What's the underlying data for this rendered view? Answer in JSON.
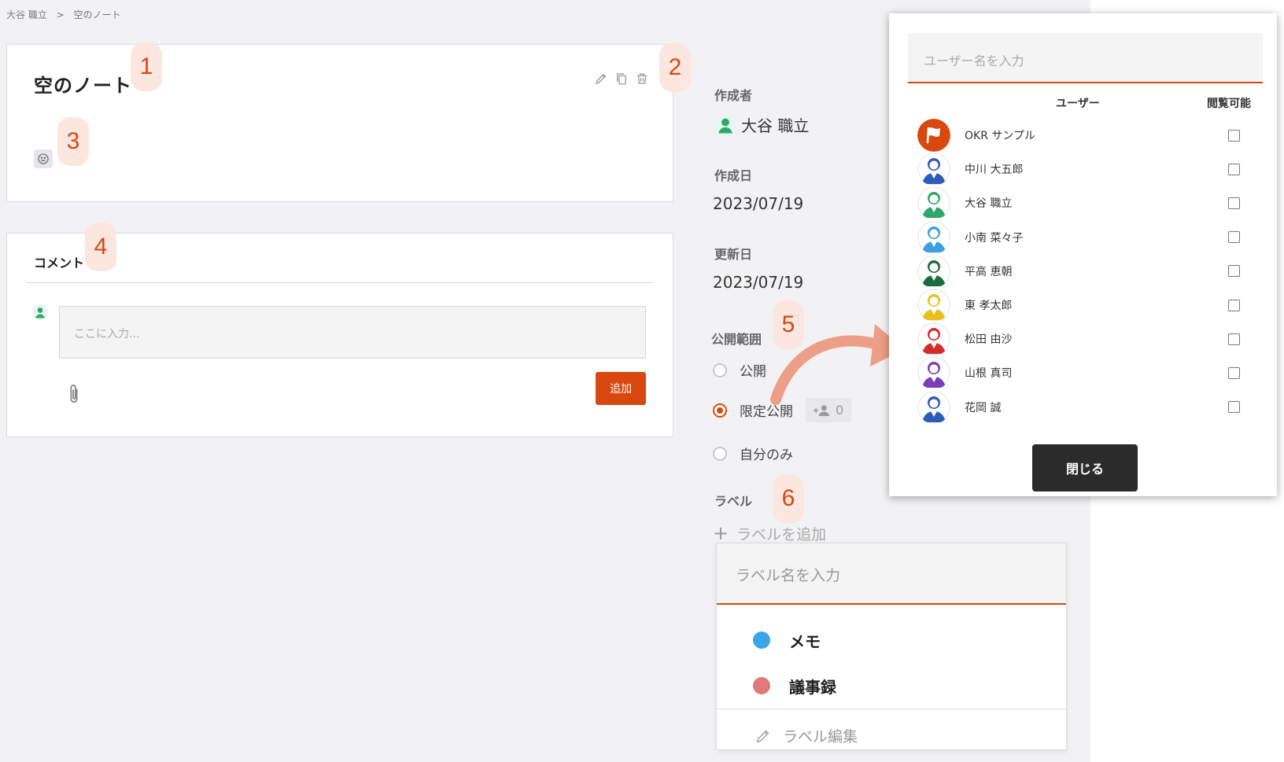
{
  "breadcrumb": {
    "owner": "大谷 職立",
    "separator": ">",
    "current": "空のノート"
  },
  "note": {
    "title": "空のノート"
  },
  "comments": {
    "title": "コメント",
    "placeholder": "ここに入力...",
    "add_label": "追加"
  },
  "sidebar": {
    "author_label": "作成者",
    "author_name": "大谷 職立",
    "created_label": "作成日",
    "created_date": "2023/07/19",
    "updated_label": "更新日",
    "updated_date": "2023/07/19",
    "visibility_label": "公開範囲",
    "visibility_options": [
      "公開",
      "限定公開",
      "自分のみ"
    ],
    "visibility_selected": "限定公開",
    "shared_count": "0",
    "labels_label": "ラベル",
    "add_label": "ラベルを追加"
  },
  "label_dropdown": {
    "placeholder": "ラベル名を入力",
    "items": [
      {
        "name": "メモ",
        "color": "#3aa6e8"
      },
      {
        "name": "議事録",
        "color": "#e07a78"
      }
    ],
    "edit_label": "ラベル編集"
  },
  "user_panel": {
    "placeholder": "ユーザー名を入力",
    "col_user": "ユーザー",
    "col_view": "閲覧可能",
    "users": [
      {
        "name": "OKR サンプル",
        "color": "#d9480f",
        "checked": false
      },
      {
        "name": "中川 大五郎",
        "color": "#2f5bb8",
        "checked": false
      },
      {
        "name": "大谷 職立",
        "color": "#2fa86a",
        "checked": false
      },
      {
        "name": "小南 菜々子",
        "color": "#3b9fe0",
        "checked": false
      },
      {
        "name": "平高 恵朝",
        "color": "#1f6b40",
        "checked": false
      },
      {
        "name": "東 孝太郎",
        "color": "#e8c21b",
        "checked": false
      },
      {
        "name": "松田 由沙",
        "color": "#d42c2c",
        "checked": false
      },
      {
        "name": "山根 真司",
        "color": "#7a3db8",
        "checked": false
      },
      {
        "name": "花岡 誠",
        "color": "#2f5bb8",
        "checked": false
      }
    ],
    "close_label": "閉じる"
  },
  "badges": [
    "1",
    "2",
    "3",
    "4",
    "5",
    "6"
  ],
  "colors": {
    "accent": "#d9480f",
    "badge_bg": "#fce6e0"
  }
}
